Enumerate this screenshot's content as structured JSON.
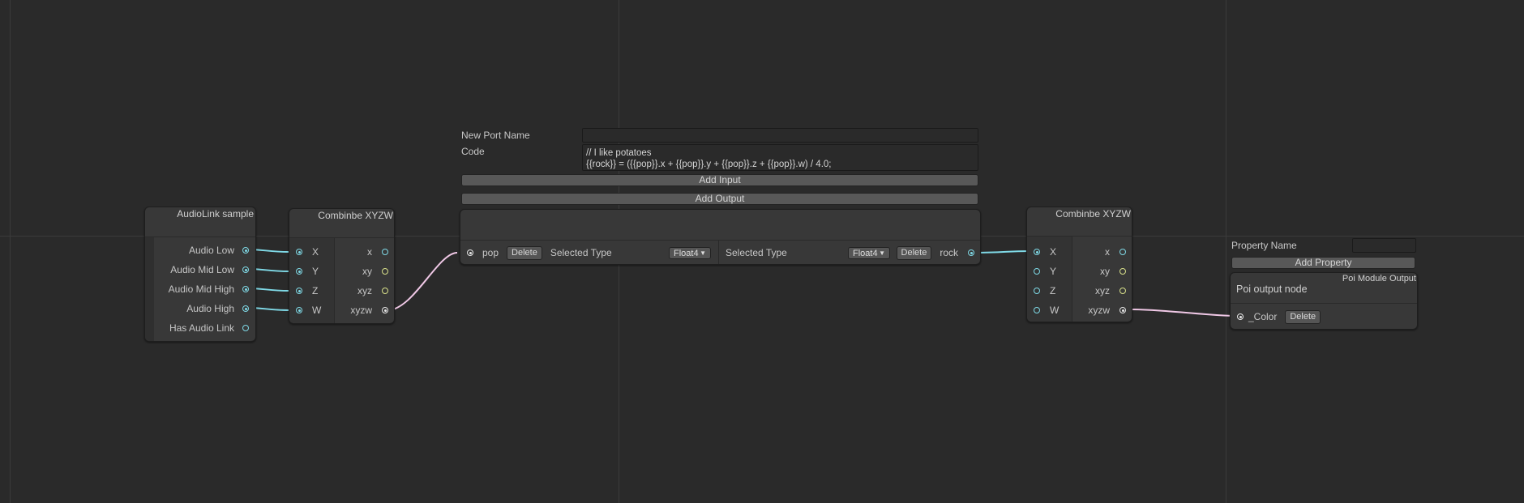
{
  "canvas": {
    "background": "#2a2a2a",
    "edge_colors": {
      "float": "#7fd9e6",
      "float4": "#f0c8e6"
    }
  },
  "audiolink_node": {
    "title": "AudioLink sample",
    "outputs": [
      "Audio Low",
      "Audio Mid Low",
      "Audio Mid High",
      "Audio High",
      "Has Audio Link"
    ]
  },
  "combine_node_1": {
    "title": "Combinbe XYZW",
    "inputs": [
      "X",
      "Y",
      "Z",
      "W"
    ],
    "outputs": [
      "x",
      "xy",
      "xyz",
      "xyzw"
    ]
  },
  "custom_code_node": {
    "new_port_name_label": "New Port Name",
    "new_port_name_value": "",
    "code_label": "Code",
    "code_lines": [
      "// I like potatoes",
      "{{rock}} = ({{pop}}.x + {{pop}}.y + {{pop}}.z + {{pop}}.w) / 4.0;"
    ],
    "add_input_label": "Add Input",
    "add_output_label": "Add Output",
    "input_port": {
      "name": "pop",
      "delete_label": "Delete",
      "type_label": "Selected Type",
      "type_value": "Float4"
    },
    "output_port": {
      "name": "rock",
      "delete_label": "Delete",
      "type_label": "Selected Type",
      "type_value": "Float4"
    }
  },
  "combine_node_2": {
    "title": "Combinbe XYZW",
    "inputs": [
      "X",
      "Y",
      "Z",
      "W"
    ],
    "outputs": [
      "x",
      "xy",
      "xyz",
      "xyzw"
    ]
  },
  "output_panel": {
    "property_name_label": "Property Name",
    "property_name_value": "",
    "add_property_label": "Add Property",
    "node_title": "Poi Module Output",
    "node_subtitle": "Poi output node",
    "port": {
      "name": "_Color",
      "delete_label": "Delete"
    }
  }
}
